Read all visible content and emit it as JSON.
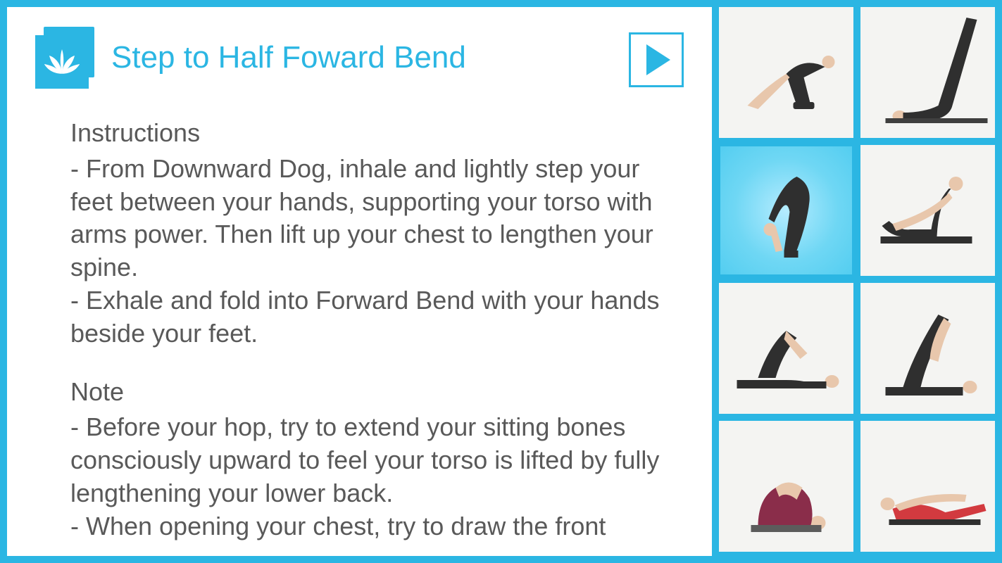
{
  "colors": {
    "accent": "#2bb6e3",
    "text": "#595959"
  },
  "header": {
    "icon_name": "lotus-icon",
    "title": "Step to Half Foward Bend",
    "play_label": "play"
  },
  "content": {
    "sections": [
      {
        "heading": "Instructions",
        "bullets": [
          "- From Downward Dog, inhale and lightly step your feet between your hands, supporting your torso with arms power. Then lift up your chest to lengthen your spine.",
          "- Exhale and fold into Forward Bend with your hands beside your feet."
        ]
      },
      {
        "heading": "Note",
        "bullets": [
          "- Before your hop, try to extend your sitting bones consciously upward to feel your torso is lifted by fully lengthening your lower back.",
          "- When opening your chest, try to draw the front"
        ]
      }
    ]
  },
  "thumbnails": [
    {
      "name": "pose-downward-dog-knees",
      "selected": false
    },
    {
      "name": "pose-shoulder-stand-legs-up",
      "selected": false
    },
    {
      "name": "pose-step-half-forward-bend",
      "selected": true
    },
    {
      "name": "pose-seated-forward-bend",
      "selected": false
    },
    {
      "name": "pose-supine-knee-bent",
      "selected": false
    },
    {
      "name": "pose-reclined-leg-raise",
      "selected": false
    },
    {
      "name": "pose-reclined-knees-to-chest",
      "selected": false
    },
    {
      "name": "pose-prone-locust",
      "selected": false
    }
  ]
}
